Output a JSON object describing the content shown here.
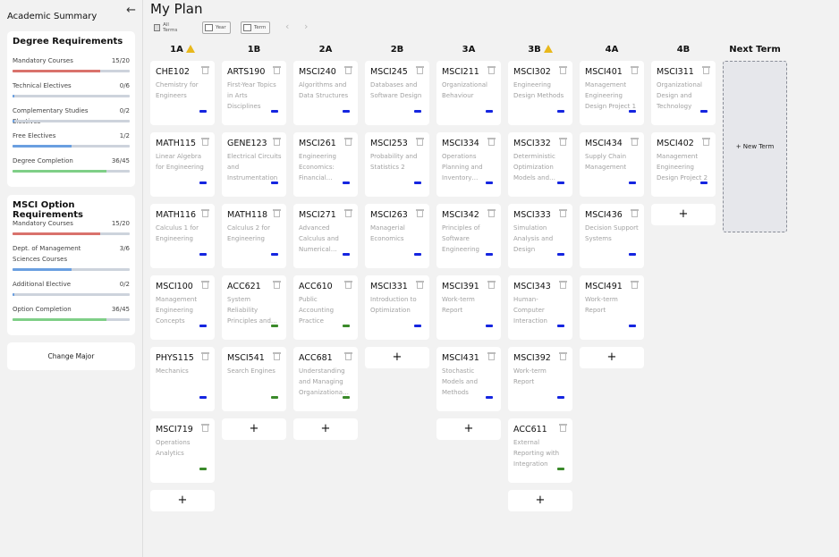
{
  "sidebar": {
    "title": "Academic Summary",
    "degree": {
      "title": "Degree Requirements",
      "items": [
        {
          "label": "Mandatory Courses",
          "count": "15/20",
          "fraction": 0.75,
          "color": "#d9726c"
        },
        {
          "label": "Technical Electives",
          "count": "0/6",
          "fraction": 0.0,
          "color": "#6a9fe0"
        },
        {
          "label": "Complementary Studies Electives",
          "count": "0/2",
          "fraction": 0.0,
          "color": "#6a9fe0"
        },
        {
          "label": "Free Electives",
          "count": "1/2",
          "fraction": 0.5,
          "color": "#6a9fe0"
        },
        {
          "label": "Degree Completion",
          "count": "36/45",
          "fraction": 0.8,
          "color": "#7fcf87"
        }
      ]
    },
    "option": {
      "title": "MSCI Option Requirements",
      "items": [
        {
          "label": "Mandatory Courses",
          "count": "15/20",
          "fraction": 0.75,
          "color": "#d9726c"
        },
        {
          "label": "Dept. of Management Sciences Courses",
          "count": "3/6",
          "fraction": 0.5,
          "color": "#6a9fe0"
        },
        {
          "label": "Additional Elective",
          "count": "0/2",
          "fraction": 0.0,
          "color": "#6a9fe0"
        },
        {
          "label": "Option Completion",
          "count": "36/45",
          "fraction": 0.8,
          "color": "#7fcf87"
        }
      ]
    },
    "change_major": "Change Major"
  },
  "main": {
    "title": "My Plan",
    "toolbar": {
      "all_terms": "All Terms",
      "year": "Year",
      "term": "Term"
    },
    "new_term": "+ New Term",
    "add_label": "+",
    "terms": [
      {
        "label": "1A",
        "warning": true,
        "courses": [
          {
            "code": "CHE102",
            "name": "Chemistry for Engineers",
            "tag": "blue"
          },
          {
            "code": "MATH115",
            "name": "Linear Algebra for Engineering",
            "tag": "blue"
          },
          {
            "code": "MATH116",
            "name": "Calculus 1 for Engineering",
            "tag": "blue"
          },
          {
            "code": "MSCI100",
            "name": "Management Engineering Concepts",
            "tag": "blue"
          },
          {
            "code": "PHYS115",
            "name": "Mechanics",
            "tag": "blue"
          },
          {
            "code": "MSCI719",
            "name": "Operations Analytics",
            "tag": "green"
          }
        ]
      },
      {
        "label": "1B",
        "warning": false,
        "courses": [
          {
            "code": "ARTS190",
            "name": "First-Year Topics in Arts Disciplines",
            "tag": "blue"
          },
          {
            "code": "GENE123",
            "name": "Electrical Circuits and Instrumentation",
            "tag": "blue"
          },
          {
            "code": "MATH118",
            "name": "Calculus 2 for Engineering",
            "tag": "blue"
          },
          {
            "code": "ACC621",
            "name": "System Reliability Principles and…",
            "tag": "green"
          },
          {
            "code": "MSCI541",
            "name": "Search Engines",
            "tag": "green"
          }
        ]
      },
      {
        "label": "2A",
        "warning": false,
        "courses": [
          {
            "code": "MSCI240",
            "name": "Algorithms and Data Structures",
            "tag": "blue"
          },
          {
            "code": "MSCI261",
            "name": "Engineering Economics: Financial…",
            "tag": "blue"
          },
          {
            "code": "MSCI271",
            "name": "Advanced Calculus and Numerical…",
            "tag": "blue"
          },
          {
            "code": "ACC610",
            "name": "Public Accounting Practice",
            "tag": "green"
          },
          {
            "code": "ACC681",
            "name": "Understanding and Managing Organizationa…",
            "tag": "green"
          }
        ]
      },
      {
        "label": "2B",
        "warning": false,
        "courses": [
          {
            "code": "MSCI245",
            "name": "Databases and Software Design",
            "tag": "blue"
          },
          {
            "code": "MSCI253",
            "name": "Probability and Statistics 2",
            "tag": "blue"
          },
          {
            "code": "MSCI263",
            "name": "Managerial Economics",
            "tag": "blue"
          },
          {
            "code": "MSCI331",
            "name": "Introduction to Optimization",
            "tag": "blue"
          }
        ]
      },
      {
        "label": "3A",
        "warning": false,
        "courses": [
          {
            "code": "MSCI211",
            "name": "Organizational Behaviour",
            "tag": "blue"
          },
          {
            "code": "MSCI334",
            "name": "Operations Planning and Inventory…",
            "tag": "blue"
          },
          {
            "code": "MSCI342",
            "name": "Principles of Software Engineering",
            "tag": "blue"
          },
          {
            "code": "MSCI391",
            "name": "Work-term Report",
            "tag": "blue"
          },
          {
            "code": "MSCI431",
            "name": "Stochastic Models and Methods",
            "tag": "blue"
          }
        ]
      },
      {
        "label": "3B",
        "warning": true,
        "courses": [
          {
            "code": "MSCI302",
            "name": "Engineering Design Methods",
            "tag": "blue"
          },
          {
            "code": "MSCI332",
            "name": "Deterministic Optimization Models and…",
            "tag": "blue"
          },
          {
            "code": "MSCI333",
            "name": "Simulation Analysis and Design",
            "tag": "blue"
          },
          {
            "code": "MSCI343",
            "name": "Human-Computer Interaction",
            "tag": "blue"
          },
          {
            "code": "MSCI392",
            "name": "Work-term Report",
            "tag": "blue"
          },
          {
            "code": "ACC611",
            "name": "External Reporting with Integration",
            "tag": "green"
          }
        ]
      },
      {
        "label": "4A",
        "warning": false,
        "courses": [
          {
            "code": "MSCI401",
            "name": "Management Engineering Design Project 1",
            "tag": "blue"
          },
          {
            "code": "MSCI434",
            "name": "Supply Chain Management",
            "tag": "blue"
          },
          {
            "code": "MSCI436",
            "name": "Decision Support Systems",
            "tag": "blue"
          },
          {
            "code": "MSCI491",
            "name": "Work-term Report",
            "tag": "blue"
          }
        ]
      },
      {
        "label": "4B",
        "warning": false,
        "courses": [
          {
            "code": "MSCI311",
            "name": "Organizational Design and Technology",
            "tag": "blue"
          },
          {
            "code": "MSCI402",
            "name": "Management Engineering Design Project 2",
            "tag": "blue"
          }
        ]
      },
      {
        "label": "Next Term",
        "warning": false,
        "courses": []
      }
    ],
    "colors": {
      "blue": "#1525e0",
      "green": "#3a8a2a"
    }
  }
}
